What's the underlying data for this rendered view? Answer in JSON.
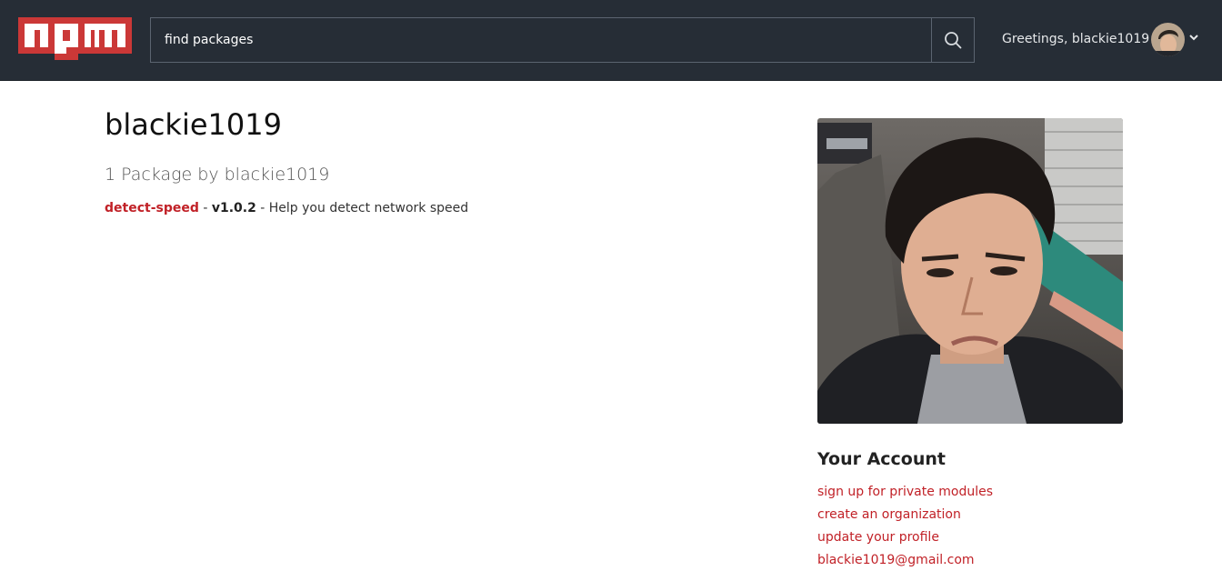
{
  "header": {
    "logo_text": "npm",
    "search": {
      "placeholder": "find packages",
      "value": ""
    },
    "greeting": "Greetings, blackie1019",
    "icons": {
      "search": "search-icon",
      "caret": "chevron-down-icon"
    }
  },
  "profile": {
    "username": "blackie1019",
    "package_count_text": "1 Package by blackie1019",
    "packages": [
      {
        "name": "detect-speed",
        "version": "v1.0.2",
        "description": "Help you detect network speed"
      }
    ],
    "separator": " - "
  },
  "account": {
    "title": "Your Account",
    "links": [
      "sign up for private modules",
      "create an organization",
      "update your profile",
      "blackie1019@gmail.com"
    ]
  },
  "colors": {
    "topbar": "#262d36",
    "brand_red": "#c12127",
    "link_red": "#c12127"
  }
}
